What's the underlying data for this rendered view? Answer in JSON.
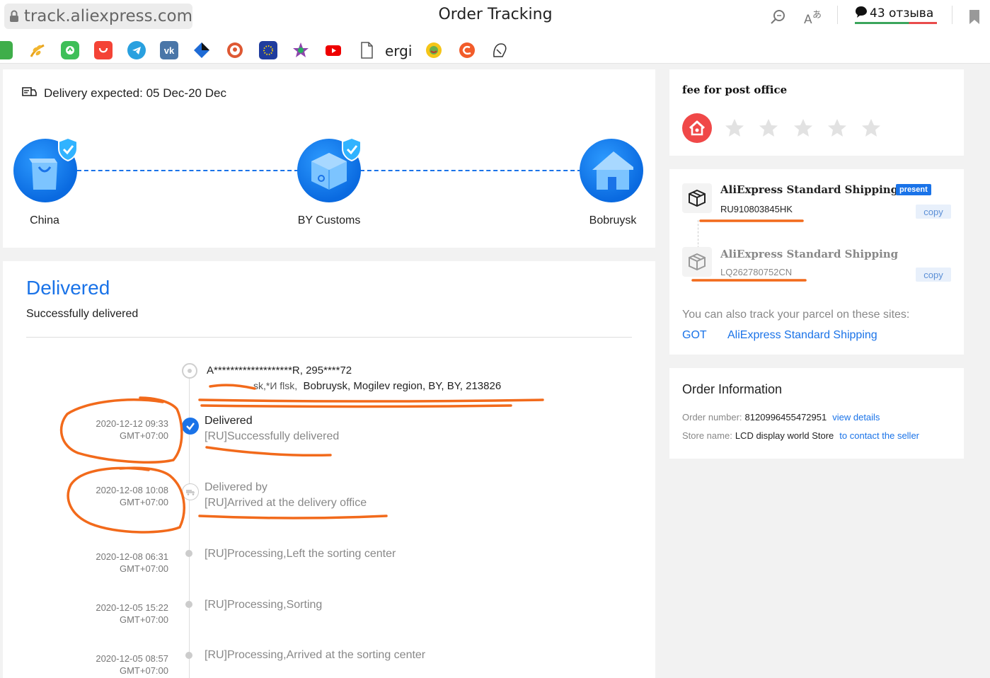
{
  "browser": {
    "url": "track.aliexpress.com",
    "title": "Order Tracking",
    "reviews_count": "43 отзыва",
    "bookmark_text": "ergi"
  },
  "delivery": {
    "expected_label": "Delivery expected: 05 Dec-20 Dec",
    "nodes": [
      {
        "label": "China"
      },
      {
        "label": "BY Customs"
      },
      {
        "label": "Bobruysk"
      }
    ]
  },
  "status": {
    "title": "Delivered",
    "subtitle": "Successfully delivered"
  },
  "address": {
    "line1": "A*******************R,  295****72",
    "line2_prefix": "sk,*И flsk,",
    "line2": "Bobruysk,  Mogilev region, BY,  BY,  213826"
  },
  "events": [
    {
      "date": "2020-12-12 09:33",
      "tz": "GMT+07:00",
      "title": "Delivered",
      "desc": "[RU]Successfully delivered"
    },
    {
      "date": "2020-12-08 10:08",
      "tz": "GMT+07:00",
      "title": "Delivered by",
      "desc": "[RU]Arrived at the delivery office"
    },
    {
      "date": "2020-12-08 06:31",
      "tz": "GMT+07:00",
      "title": "",
      "desc": "[RU]Processing,Left the sorting center"
    },
    {
      "date": "2020-12-05 15:22",
      "tz": "GMT+07:00",
      "title": "",
      "desc": "[RU]Processing,Sorting"
    },
    {
      "date": "2020-12-05 08:57",
      "tz": "GMT+07:00",
      "title": "",
      "desc": "[RU]Processing,Arrived at the sorting center"
    }
  ],
  "rating": {
    "title": "fee for post office",
    "stars_filled": 0,
    "stars_total": 5
  },
  "shipping": {
    "items": [
      {
        "name": "AliExpress Standard Shipping",
        "badge": "present",
        "number": "RU910803845HK",
        "copy": "copy"
      },
      {
        "name": "AliExpress Standard Shipping",
        "badge": "",
        "number": "LQ262780752CN",
        "copy": "copy"
      }
    ],
    "track_also": "You can also track your parcel on these sites:",
    "links": [
      "GOT",
      "AliExpress Standard Shipping"
    ]
  },
  "order": {
    "title": "Order Information",
    "number_label": "Order number:",
    "number": "8120996455472951",
    "view_details": "view details",
    "store_label": "Store name:",
    "store": "LCD display world Store",
    "contact": "to contact the seller"
  },
  "colors": {
    "accent": "#1a73e8",
    "annotation": "#f26a1b",
    "post_icon": "#f04848"
  }
}
